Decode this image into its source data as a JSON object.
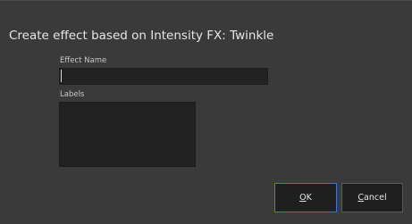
{
  "dialog": {
    "title": "Create effect based on Intensity FX: Twinkle",
    "effect_name": {
      "label": "Effect Name",
      "value": ""
    },
    "labels": {
      "label": "Labels",
      "value": ""
    },
    "buttons": {
      "ok": {
        "mnemonic": "O",
        "rest": "K"
      },
      "cancel": {
        "mnemonic": "C",
        "rest": "ancel"
      }
    },
    "colors": {
      "background": "#3a3a3a",
      "field": "#222222",
      "button": "#1f1f1f",
      "accent": "#3c78d8",
      "text": "#e6e6e6"
    }
  }
}
